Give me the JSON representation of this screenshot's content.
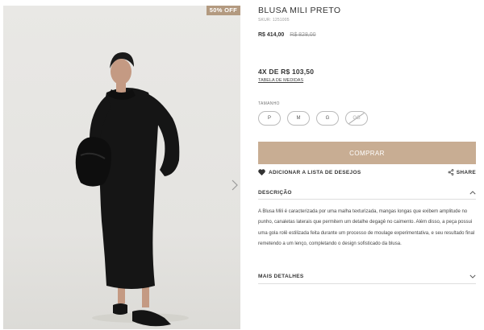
{
  "image": {
    "badge": "50% OFF",
    "next_icon": "chevron-right-icon"
  },
  "product": {
    "title": "BLUSA MILI PRETO",
    "sku": "SKUR: 1251005",
    "price": "R$ 414,00",
    "old_price": "R$ 828,00",
    "installments": "4X DE R$ 103,50",
    "size_table_link": "TABELA DE MEDIDAS"
  },
  "sizes": {
    "label": "TAMANHO",
    "options": [
      {
        "label": "P",
        "available": true
      },
      {
        "label": "M",
        "available": true
      },
      {
        "label": "G",
        "available": true
      },
      {
        "label": "GG",
        "available": false
      }
    ]
  },
  "actions": {
    "buy_label": "COMPRAR",
    "wishlist_label": "ADICIONAR A LISTA DE DESEJOS",
    "wishlist_icon": "heart-icon",
    "share_label": "SHARE",
    "share_icon": "share-icon"
  },
  "description": {
    "heading": "DESCRIÇÃO",
    "text": "A Blusa Mili é caracterizada por uma malha texturizada, mangas longas que exibem amplitude no punho, canaletas laterais que permitem um detalhe degagê no caimento. Além disso, a peça possui uma gola rolê estilizada feita durante um processo de moulage experimentativa, e seu resultado final remetendo a um lenço, completando o design sofisticado da blusa."
  },
  "details": {
    "heading": "MAIS DETALHES"
  },
  "colors": {
    "accent": "#c8ad93",
    "badge": "#b39a80"
  }
}
